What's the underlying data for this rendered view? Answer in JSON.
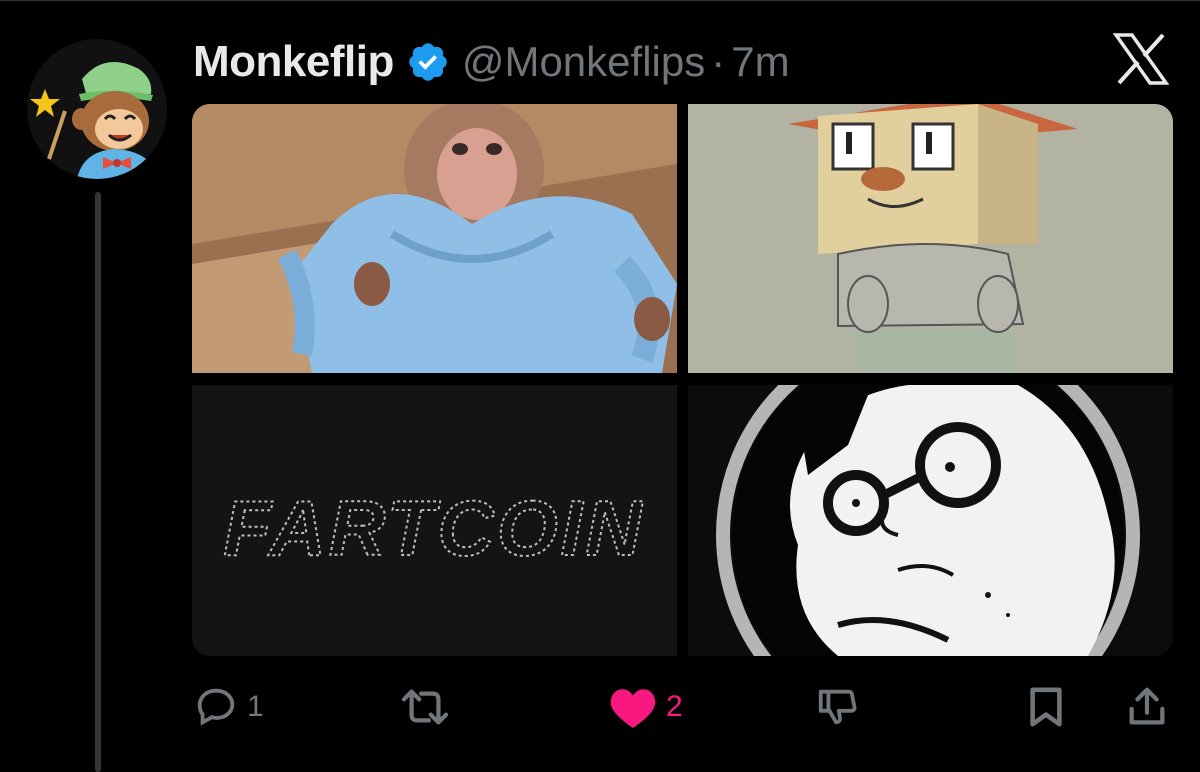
{
  "tweet": {
    "author_name": "Monkeflip",
    "handle": "@Monkeflips",
    "separator": "·",
    "time": "7m"
  },
  "media": {
    "tile_3_text": "FARTCOIN"
  },
  "actions": {
    "reply_count": "1",
    "retweet_count": "",
    "like_count": "2"
  },
  "colors": {
    "background": "#000000",
    "name": "#e7e9ea",
    "muted": "#71767b",
    "verified": "#1d9bf0",
    "like": "#f91880"
  },
  "icons": [
    "verified-badge-icon",
    "x-logo-icon",
    "reply-icon",
    "retweet-icon",
    "heart-icon",
    "dislike-icon",
    "bookmark-icon",
    "share-icon"
  ]
}
